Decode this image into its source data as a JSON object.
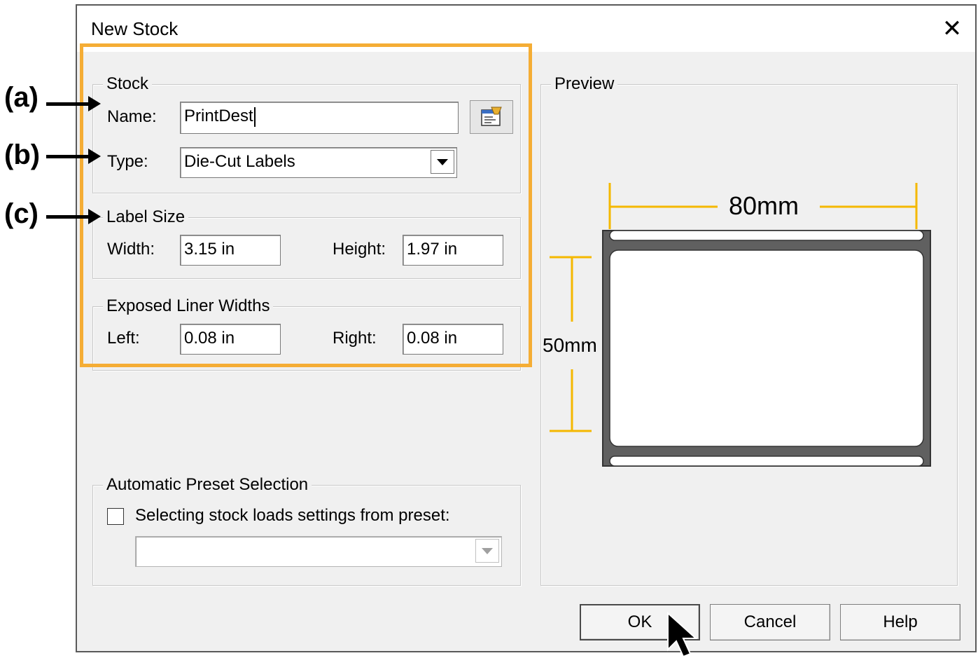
{
  "dialog": {
    "title": "New Stock",
    "close_symbol": "✕"
  },
  "stock": {
    "legend": "Stock",
    "name_label": "Name:",
    "name_value": "PrintDest",
    "type_label": "Type:",
    "type_value": "Die-Cut Labels"
  },
  "label_size": {
    "legend": "Label Size",
    "width_label": "Width:",
    "width_value": "3.15 in",
    "height_label": "Height:",
    "height_value": "1.97 in"
  },
  "liner": {
    "legend": "Exposed Liner Widths",
    "left_label": "Left:",
    "left_value": "0.08 in",
    "right_label": "Right:",
    "right_value": "0.08 in"
  },
  "preset": {
    "legend": "Automatic Preset Selection",
    "checkbox_label": "Selecting stock loads settings from preset:",
    "checked": false,
    "select_value": ""
  },
  "preview": {
    "legend": "Preview",
    "width_dim": "80mm",
    "height_dim": "50mm"
  },
  "buttons": {
    "ok": "OK",
    "cancel": "Cancel",
    "help": "Help"
  },
  "annotations": {
    "a": "(a)",
    "b": "(b)",
    "c": "(c)"
  },
  "colors": {
    "highlight": "#f5ad35",
    "dimension_line": "#f5b800",
    "label_stock": "#606060"
  }
}
